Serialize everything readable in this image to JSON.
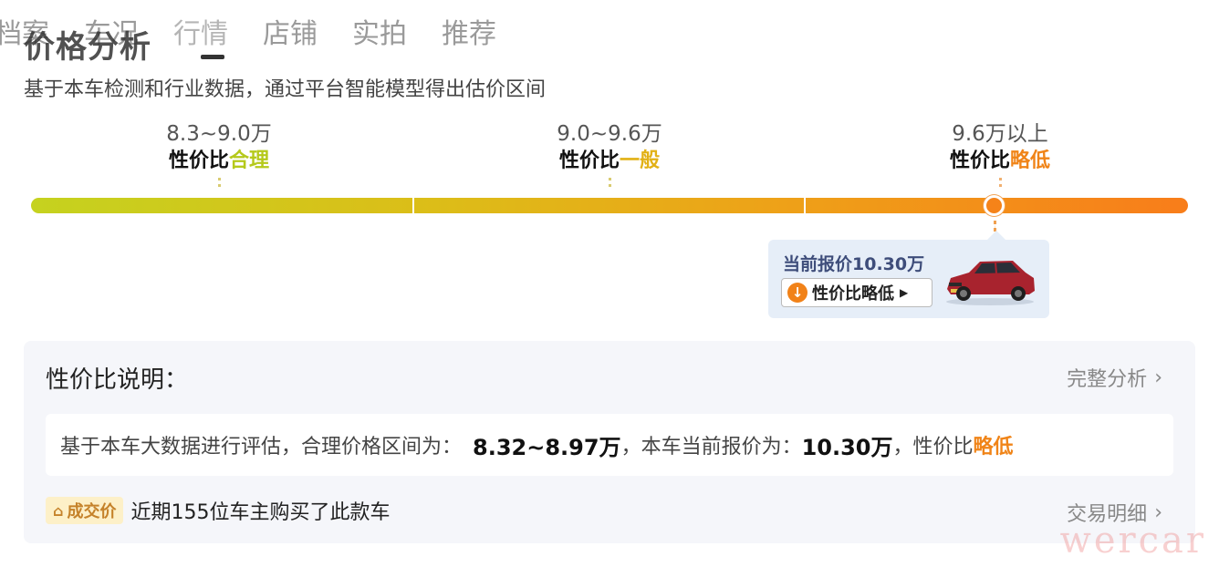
{
  "tabs": [
    "档案",
    "车况",
    "行情",
    "店铺",
    "实拍",
    "推荐"
  ],
  "active_tab": "行情",
  "title": "价格分析",
  "subtitle": "基于本车检测和行业数据，通过平台智能模型得出估价区间",
  "ranges": [
    {
      "price": "8.3~9.0万",
      "prefix": "性价比",
      "level": "合理",
      "color": "#b5c91b"
    },
    {
      "price": "9.0~9.6万",
      "prefix": "性价比",
      "level": "一般",
      "color": "#e2b116"
    },
    {
      "price": "9.6万以上",
      "prefix": "性价比",
      "level": "略低",
      "color": "#f08418"
    }
  ],
  "current": {
    "price_label": "当前报价10.30万",
    "tag": "性价比略低",
    "icon": "arrow-down-circle-icon"
  },
  "card": {
    "title": "性价比说明：",
    "full_analysis": "完整分析",
    "desc_prefix": "基于本车大数据进行评估，合理价格区间为：",
    "desc_range": "8.32~8.97万",
    "desc_mid": "，本车当前报价为：",
    "desc_price": "10.30万",
    "desc_suffix": "，性价比",
    "desc_level": "略低",
    "deal_badge": "成交价",
    "deal_text": "近期155位车主购买了此款车",
    "deal_link": "交易明细"
  },
  "watermark": "wercar",
  "colors": {
    "accent_orange": "#f08418",
    "bubble_bg": "#e6eef8",
    "card_bg": "#f5f6fa"
  }
}
